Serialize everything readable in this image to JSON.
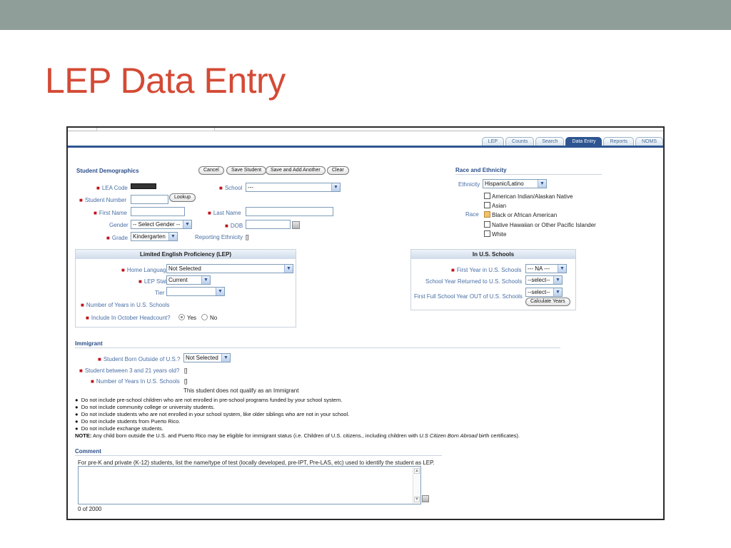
{
  "slide": {
    "title": "LEP Data Entry"
  },
  "tabs": [
    "LEP",
    "Counts",
    "Search",
    "Data Entry",
    "Reports",
    "NOMS"
  ],
  "active_tab": "Data Entry",
  "demographics": {
    "title": "Student Demographics",
    "buttons": {
      "cancel": "Cancel",
      "save": "Save Student",
      "save_add": "Save and Add Another",
      "clear": "Clear"
    },
    "lea_code_label": "LEA Code",
    "school_label": "School",
    "school_value": "---",
    "student_number_label": "Student Number",
    "lookup_label": "Lookup",
    "first_name_label": "First Name",
    "last_name_label": "Last Name",
    "gender_label": "Gender",
    "gender_value": "-- Select Gender --",
    "dob_label": "DOB",
    "grade_label": "Grade",
    "grade_value": "Kindergarten",
    "reporting_ethnicity_label": "Reporting Ethnicity",
    "reporting_ethnicity_value": "[]"
  },
  "race": {
    "title": "Race and Ethnicity",
    "ethnicity_label": "Ethnicity",
    "ethnicity_value": "Hispanic/Latino",
    "race_label": "Race",
    "options": [
      "American Indian/Alaskan Native",
      "Asian",
      "Black or African American",
      "Native Hawaiian or Other Pacific Islander",
      "White"
    ]
  },
  "lep": {
    "title": "Limited English Proficiency (LEP)",
    "home_language_label": "Home Language",
    "home_language_value": "Not Selected",
    "lep_status_label": "LEP Status",
    "lep_status_value": "Current",
    "tier_label": "Tier",
    "years_label": "Number of Years in U.S. Schools",
    "october_label": "Include In October Headcount?",
    "yes_label": "Yes",
    "no_label": "No"
  },
  "us_schools": {
    "title": "In U.S. Schools",
    "first_year_label": "First Year in U.S. Schools",
    "first_year_value": "--- NA ---",
    "returned_label": "School Year Returned to U.S. Schools",
    "returned_value": "--select--",
    "out_label": "First Full School Year OUT of U.S. Schools",
    "out_value": "--select--",
    "calc_label": "Calculate Years"
  },
  "immigrant": {
    "title": "Immigrant",
    "born_label": "Student Born Outside of U.S.?",
    "born_value": "Not Selected",
    "age_label": "Student between 3 and 21 years old?",
    "age_value": "[]",
    "years_label": "Number of Years In U.S. Schools",
    "years_value": "[]",
    "qualify_text": "This student does not qualify as an Immigrant",
    "bullets": [
      "Do not include pre-school children who are not enrolled in pre-school programs funded by your school system.",
      "Do not include community college or university students.",
      "Do not include students who are not enrolled in your school system, like older siblings who are not in your school.",
      "Do not include students from Puerto Rico.",
      "Do not include exchange students."
    ],
    "note_label": "NOTE:",
    "note_text_a": "Any child born outside the U.S. and Puerto Rico may be eligible for immigrant status (i.e. Children of U.S. citizens., including children with ",
    "note_text_italic": "U.S Citizen Born Abroad",
    "note_text_b": " birth certificates)."
  },
  "comment": {
    "title": "Comment",
    "instruction": "For pre-K and private (K-12) students, list the name/type of test (locally developed, pre-IPT, Pre-LAS, etc) used to identify the student as LEP.",
    "counter": "0 of 2000"
  },
  "colors": {
    "slide_title": "#d44a35",
    "topbar": "#8f9e98",
    "accent": "#2e5591",
    "required": "#c0121b"
  }
}
